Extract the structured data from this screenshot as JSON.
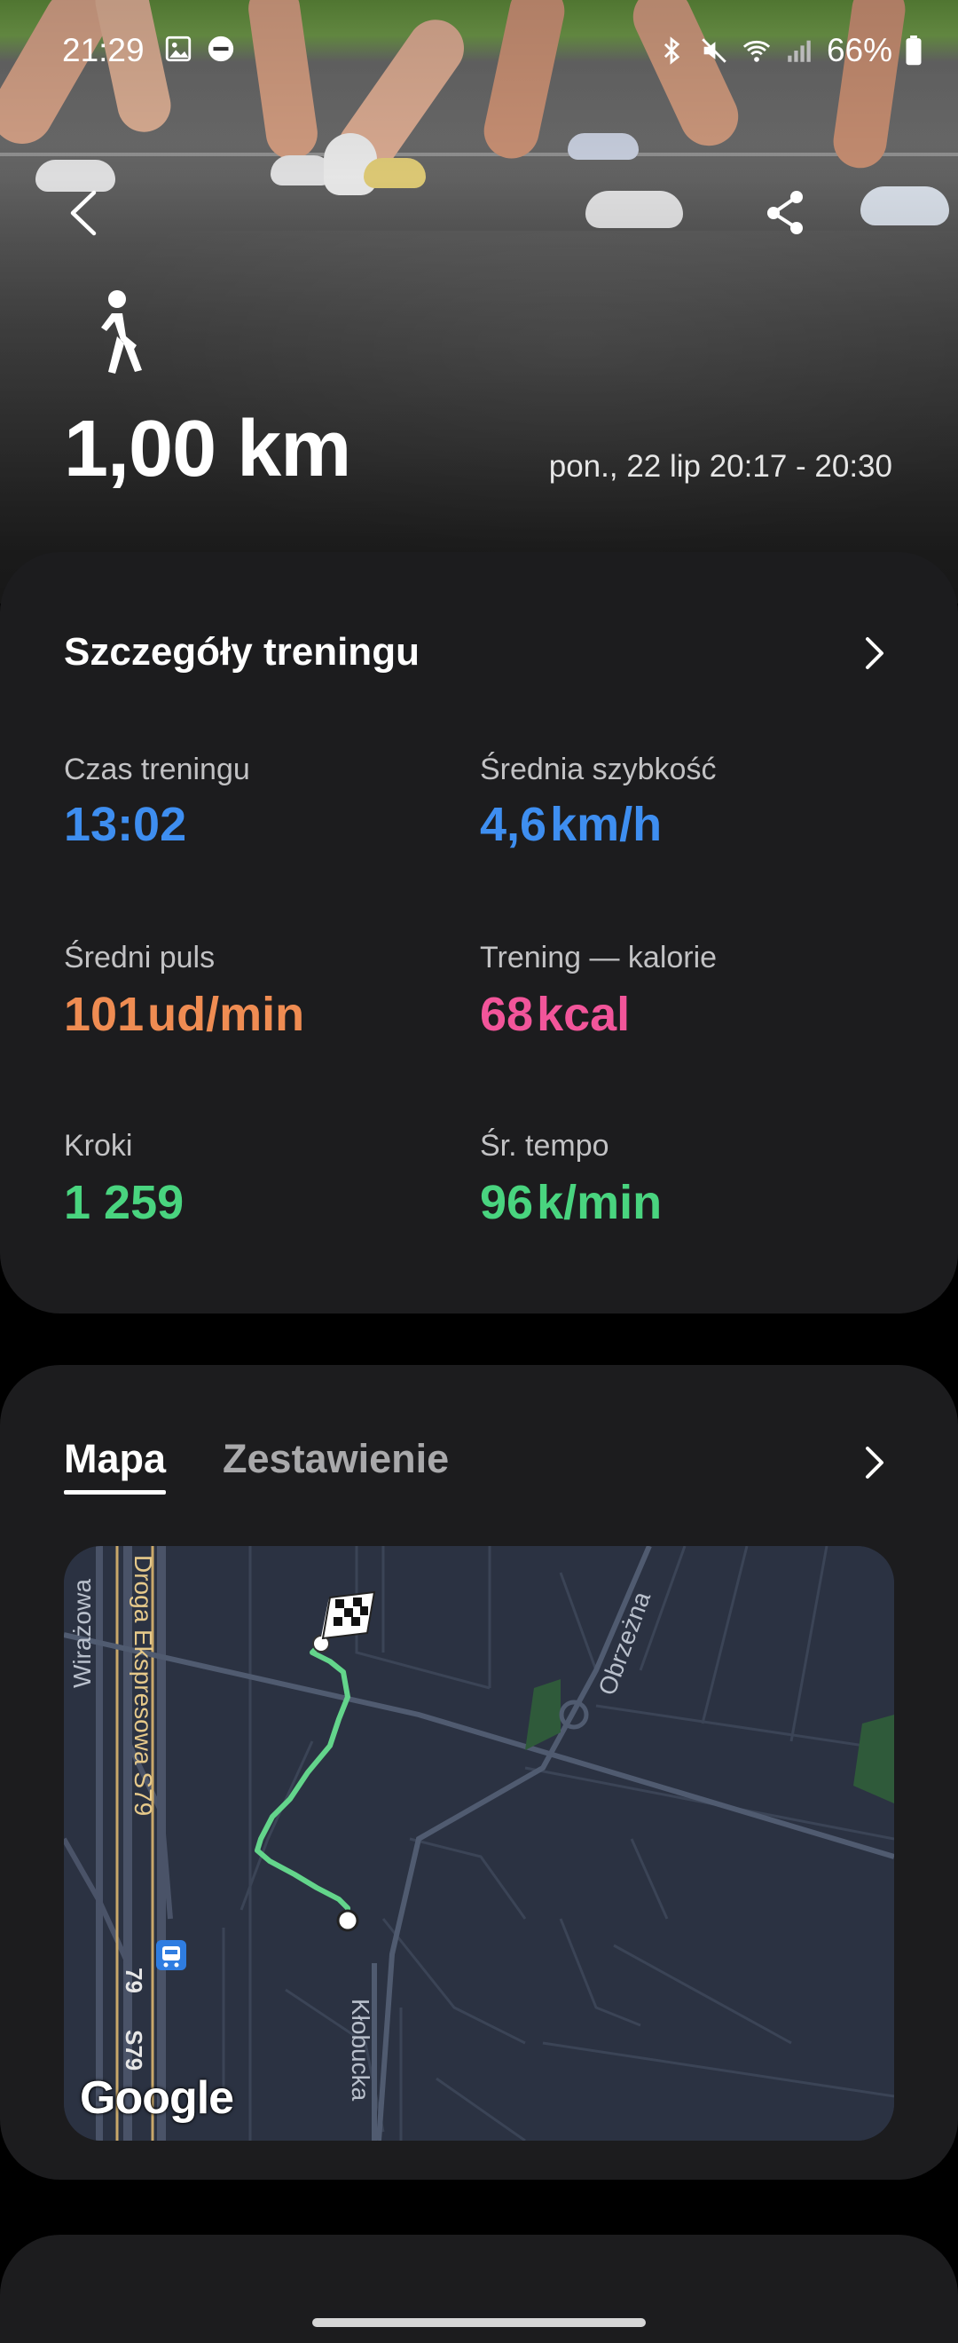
{
  "status_bar": {
    "time": "21:29",
    "battery": "66%",
    "left_icons": [
      "gallery-icon",
      "do-not-disturb-icon"
    ],
    "right_icons": [
      "bluetooth-icon",
      "mute-icon",
      "wifi-icon",
      "signal-icon",
      "battery-icon"
    ]
  },
  "header": {
    "activity_icon": "walking-icon",
    "distance": "1,00 km",
    "date_range": "pon., 22 lip 20:17 - 20:30"
  },
  "details": {
    "title": "Szczegóły treningu",
    "metrics": [
      {
        "label": "Czas treningu",
        "value": "13:02",
        "unit": "",
        "color": "#3e8ef0"
      },
      {
        "label": "Średnia szybkość",
        "value": "4,6",
        "unit": "km/h",
        "color": "#3e8ef0"
      },
      {
        "label": "Średni puls",
        "value": "101",
        "unit": "ud/min",
        "color": "#ef8c52"
      },
      {
        "label": "Trening — kalorie",
        "value": "68",
        "unit": "kcal",
        "color": "#f2559a"
      },
      {
        "label": "Kroki",
        "value": "1 259",
        "unit": "",
        "color": "#49d47f"
      },
      {
        "label": "Śr. tempo",
        "value": "96",
        "unit": "k/min",
        "color": "#49d47f"
      }
    ]
  },
  "map_section": {
    "tabs": [
      {
        "label": "Mapa",
        "active": true
      },
      {
        "label": "Zestawienie",
        "active": false
      }
    ],
    "street_labels": [
      "Wirażowa",
      "Droga Ekspresowa S79",
      "Obrzeżna",
      "Kłobucka",
      "79",
      "S79"
    ],
    "attribution": "Google",
    "route_color": "#63d58b"
  },
  "colors": {
    "card_bg": "#1c1c1e",
    "blue": "#3e8ef0",
    "orange": "#ef8c52",
    "pink": "#f2559a",
    "green": "#49d47f"
  }
}
